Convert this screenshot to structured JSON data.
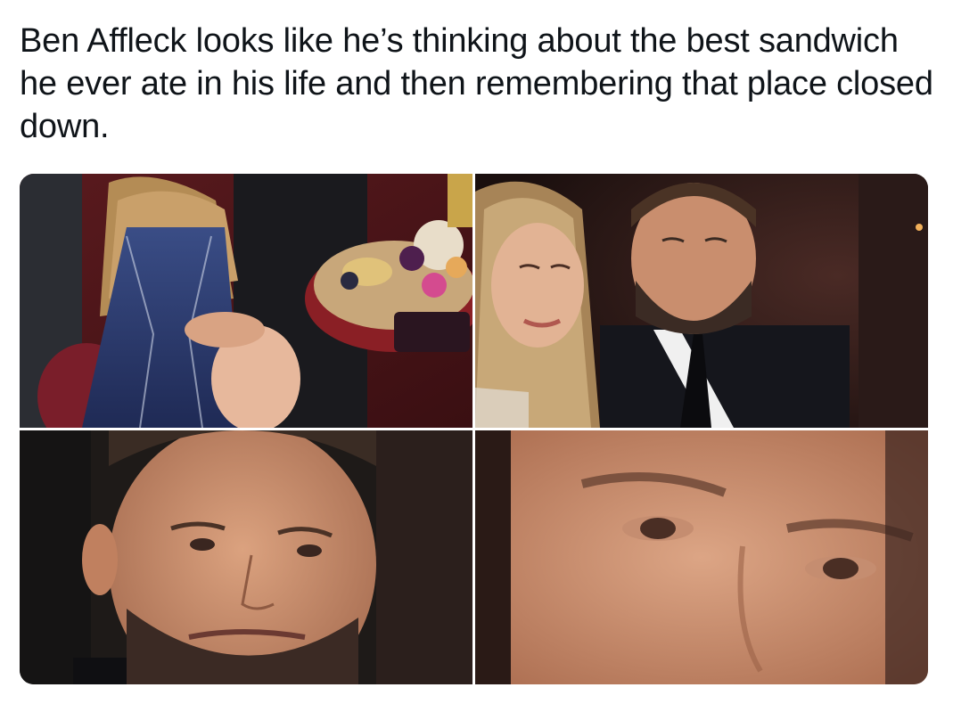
{
  "tweet": {
    "text": "Ben Affleck looks like he’s thinking about the best sandwich he ever ate in his life and then remembering that place closed down."
  },
  "media": {
    "count": 4,
    "images": [
      {
        "description": "couple-seated-at-table-with-fruit-platter"
      },
      {
        "description": "couple-posing-close-up"
      },
      {
        "description": "man-face-zoomed"
      },
      {
        "description": "man-eyes-extreme-zoom"
      }
    ]
  },
  "colors": {
    "text": "#0f1419",
    "background": "#ffffff"
  }
}
